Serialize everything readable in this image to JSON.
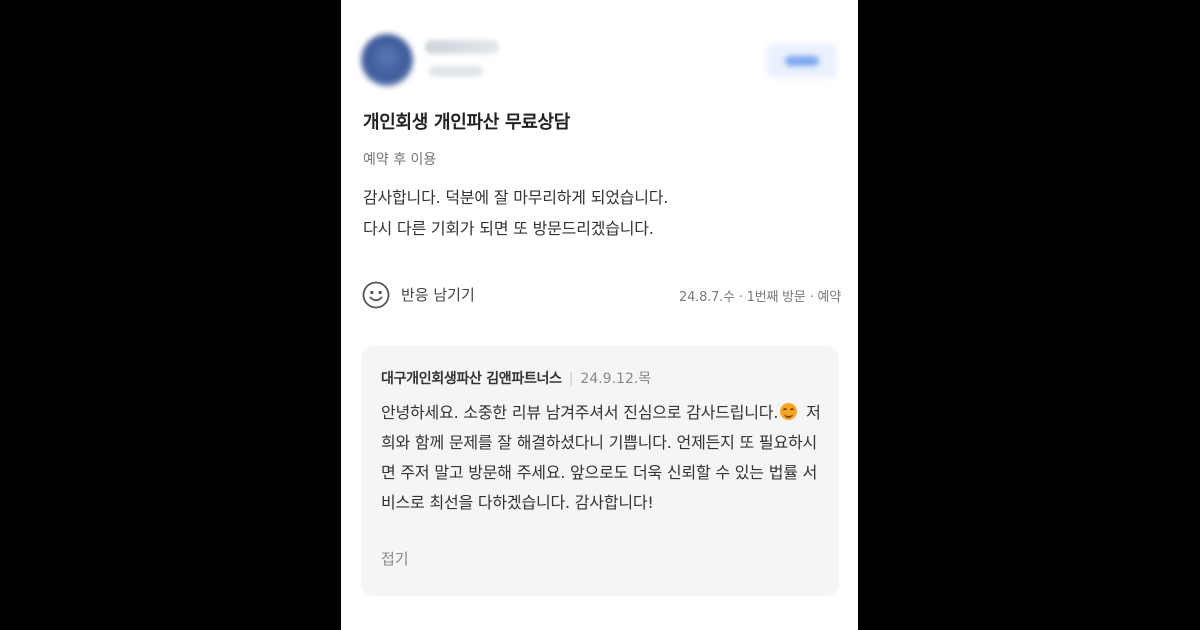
{
  "review": {
    "title": "개인회생 개인파산 무료상담",
    "meta": "예약 후 이용",
    "body_lines": [
      "감사합니다. 덕분에 잘 마무리하게 되었습니다.",
      "다시 다른 기회가 되면 또 방문드리겠습니다."
    ],
    "reaction_label": "반응 남기기",
    "visit_info": "24.8.7.수 · 1번째 방문 · 예약"
  },
  "reply": {
    "owner_name": "대구개인회생파산 김앤파트너스",
    "separator": "|",
    "date": "24.9.12.목",
    "text_before_emoji": "안녕하세요. 소중한 리뷰 남겨주셔서 진심으로 감사드립니다.",
    "text_after_emoji": " 저희와 함께 문제를 잘 해결하셨다니 기쁩니다. 언제든지 또 필요하시면 주저 말고 방문해 주세요. 앞으로도 더욱 신뢰할 수 있는 법률 서비스로 최선을 다하겠습니다. 감사합니다!",
    "collapse_label": "접기"
  },
  "icons": {
    "reaction": "smile-icon",
    "reply_emoji": "smiling-face-emoji-icon"
  },
  "colors": {
    "background": "#000000",
    "card": "#ffffff",
    "reply_box": "#f4f5f7",
    "emoji": "#f5a623"
  }
}
